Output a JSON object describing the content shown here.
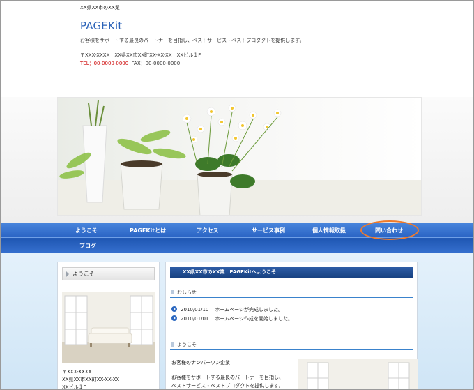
{
  "header": {
    "tagline": "XX県XX市のXX業",
    "site_title": "PAGEKit",
    "description": "お客様をサポートする最良のパートナーを目指し、ベストサービス・ベストプロダクトを提供します。",
    "address": "〒XXX-XXXX　XX県XX市XX町XX-XX-XX　XXビル１F",
    "tel": "TEL：00-0000-0000",
    "fax": "FAX：00-0000-0000"
  },
  "nav": {
    "items": [
      {
        "label": "ようこそ"
      },
      {
        "label": "PAGEKitとは"
      },
      {
        "label": "アクセス"
      },
      {
        "label": "サービス事例"
      },
      {
        "label": "個人情報取扱"
      },
      {
        "label": "問い合わせ"
      },
      {
        "label": "ブログ"
      }
    ]
  },
  "sidebar": {
    "title": "ようこそ",
    "address_lines": [
      "〒XXX-XXXX",
      "XX県XX市XX町XX-XX-XX",
      "XXビル１F"
    ]
  },
  "main": {
    "heading": "XX県XX市のXX業　PAGEKitへようこそ",
    "news_title": "おしらせ",
    "news": [
      {
        "date": "2010/01/10",
        "text": "ホームページが完成しました。"
      },
      {
        "date": "2010/01/01",
        "text": "ホームページ作成を開始しました。"
      }
    ],
    "welcome_title": "ようこそ",
    "welcome_lead": "お客様のナンバーワン企業",
    "welcome_body_1": "お客様をサポートする最良のパートナーを目指し、",
    "welcome_body_2": "ベストサービス・ベストプロダクトを提供します。"
  },
  "colors": {
    "brand": "#2a62b8",
    "nav": "#2a64c4",
    "highlight": "#f07a2a",
    "tel": "#cc0000"
  },
  "icons": {
    "side_bullet": "triangle-right-icon",
    "news_bullet": "circle-play-icon",
    "section_marker": "bar-icon"
  }
}
